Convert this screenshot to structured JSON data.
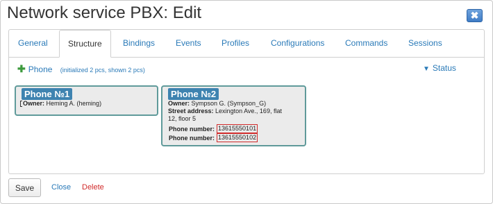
{
  "window": {
    "title": "Network service PBX: Edit",
    "close_symbol": "✖"
  },
  "tabs": [
    {
      "label": "General"
    },
    {
      "label": "Structure"
    },
    {
      "label": "Bindings"
    },
    {
      "label": "Events"
    },
    {
      "label": "Profiles"
    },
    {
      "label": "Configurations"
    },
    {
      "label": "Commands"
    },
    {
      "label": "Sessions"
    }
  ],
  "toolbar": {
    "add_symbol": "✚",
    "add_label": "Phone",
    "init_note": "(initialized 2 pcs, shown 2 pcs)",
    "filter_symbol": "▼",
    "filter_label": "Status"
  },
  "cards": [
    {
      "title": "Phone №1",
      "owner_label": "Owner:",
      "owner_value": "Heming A. (heming)"
    },
    {
      "title": "Phone №2",
      "owner_label": "Owner:",
      "owner_value": "Sympson G. (Sympson_G)",
      "street_label": "Street address:",
      "street_value_1": "Lexington Ave., 169, flat",
      "street_value_2": "12, floor 5",
      "phone_label": "Phone number:",
      "phones": [
        "13615550101",
        "13615550102"
      ]
    }
  ],
  "footer": {
    "save_label": "Save",
    "close_label": "Close",
    "delete_label": "Delete"
  },
  "colors": {
    "accent": "#2a7ab8",
    "card_header": "#3e83b0",
    "card_border": "#5f9a9a",
    "danger": "#d12b2b"
  }
}
